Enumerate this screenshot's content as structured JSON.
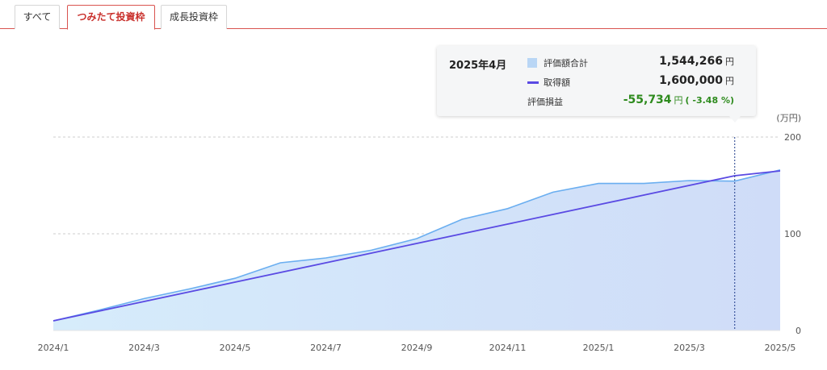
{
  "tabs": [
    {
      "label": "すべて",
      "active": false
    },
    {
      "label": "つみたて投資枠",
      "active": true
    },
    {
      "label": "成長投資枠",
      "active": false
    }
  ],
  "tooltip": {
    "date": "2025年4月",
    "rows": [
      {
        "label": "評価額合計",
        "value": "1,544,266",
        "unit": "円"
      },
      {
        "label": "取得額",
        "value": "1,600,000",
        "unit": "円"
      },
      {
        "label": "評価損益",
        "value": "-55,734",
        "unit": "円",
        "pct": "( -3.48 %)"
      }
    ]
  },
  "colors": {
    "tab_accent": "#d9534f",
    "area_fill_top": "#b9d6f5",
    "area_line": "#6aaef0",
    "acquisition_line": "#5a4ae3",
    "loss_green": "#2e8b1e"
  },
  "chart_data": {
    "type": "area",
    "y_unit_label": "(万円)",
    "ylim": [
      0,
      200
    ],
    "y_ticks": [
      0,
      100,
      200
    ],
    "grid": true,
    "x": [
      "2024/1",
      "2024/2",
      "2024/3",
      "2024/4",
      "2024/5",
      "2024/6",
      "2024/7",
      "2024/8",
      "2024/9",
      "2024/10",
      "2024/11",
      "2024/12",
      "2025/1",
      "2025/2",
      "2025/3",
      "2025/4",
      "2025/5"
    ],
    "x_tick_labels": [
      "2024/1",
      "2024/3",
      "2024/5",
      "2024/7",
      "2024/9",
      "2024/11",
      "2025/1",
      "2025/3",
      "2025/5"
    ],
    "series": [
      {
        "name": "評価額合計",
        "kind": "area",
        "values": [
          10,
          21,
          33,
          43,
          54,
          70,
          75,
          83,
          95,
          115,
          126,
          143,
          152,
          152,
          155,
          154.4266,
          166
        ]
      },
      {
        "name": "取得額",
        "kind": "line",
        "values": [
          10,
          20,
          30,
          40,
          50,
          60,
          70,
          80,
          90,
          100,
          110,
          120,
          130,
          140,
          150,
          160,
          165
        ]
      }
    ],
    "highlight_x": "2025/4"
  }
}
